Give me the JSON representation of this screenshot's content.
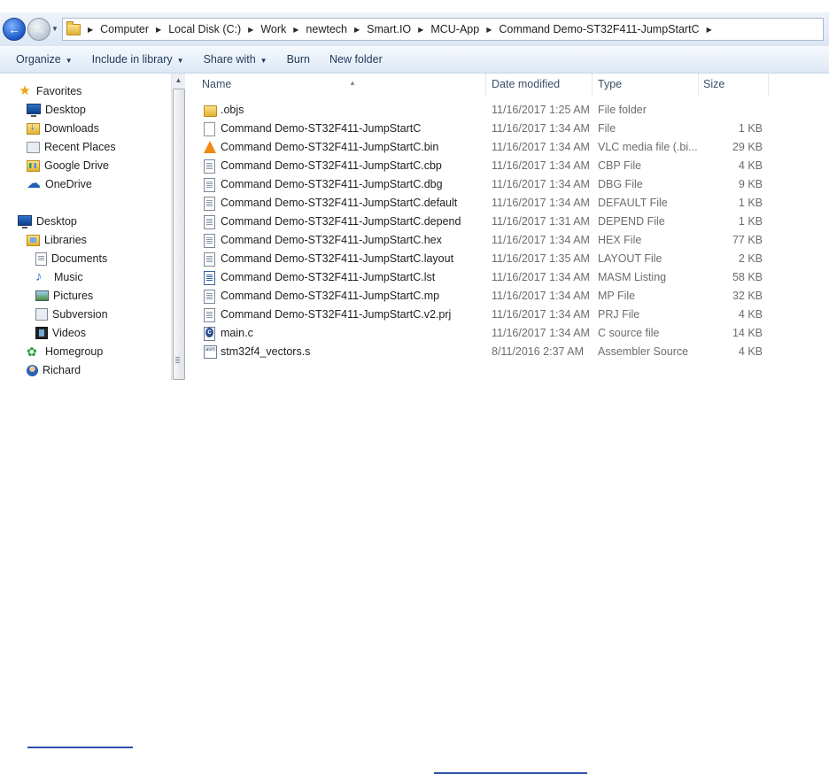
{
  "address": {
    "crumbs": [
      "Computer",
      "Local Disk (C:)",
      "Work",
      "newtech",
      "Smart.IO",
      "MCU-App",
      "Command Demo-ST32F411-JumpStartC"
    ]
  },
  "toolbar": {
    "organize": "Organize",
    "include_in_library": "Include in library",
    "share_with": "Share with",
    "burn": "Burn",
    "new_folder": "New folder"
  },
  "nav": {
    "favorites": "Favorites",
    "fav_items": [
      "Desktop",
      "Downloads",
      "Recent Places",
      "Google Drive",
      "OneDrive"
    ],
    "desktop": "Desktop",
    "libraries": "Libraries",
    "lib_items": [
      "Documents",
      "Music",
      "Pictures",
      "Subversion",
      "Videos"
    ],
    "homegroup": "Homegroup",
    "user": "Richard"
  },
  "columns": {
    "name": "Name",
    "date": "Date modified",
    "type": "Type",
    "size": "Size"
  },
  "files": [
    {
      "name": ".objs",
      "date": "11/16/2017 1:25 AM",
      "type": "File folder",
      "size": "",
      "icon": "folder-icon"
    },
    {
      "name": "Command Demo-ST32F411-JumpStartC",
      "date": "11/16/2017 1:34 AM",
      "type": "File",
      "size": "1 KB",
      "icon": "file-icon"
    },
    {
      "name": "Command Demo-ST32F411-JumpStartC.bin",
      "date": "11/16/2017 1:34 AM",
      "type": "VLC media file (.bi...",
      "size": "29 KB",
      "icon": "vlc-icon"
    },
    {
      "name": "Command Demo-ST32F411-JumpStartC.cbp",
      "date": "11/16/2017 1:34 AM",
      "type": "CBP File",
      "size": "4 KB",
      "icon": "text-file-icon"
    },
    {
      "name": "Command Demo-ST32F411-JumpStartC.dbg",
      "date": "11/16/2017 1:34 AM",
      "type": "DBG File",
      "size": "9 KB",
      "icon": "text-file-icon"
    },
    {
      "name": "Command Demo-ST32F411-JumpStartC.default",
      "date": "11/16/2017 1:34 AM",
      "type": "DEFAULT File",
      "size": "1 KB",
      "icon": "text-file-icon"
    },
    {
      "name": "Command Demo-ST32F411-JumpStartC.depend",
      "date": "11/16/2017 1:31 AM",
      "type": "DEPEND File",
      "size": "1 KB",
      "icon": "text-file-icon"
    },
    {
      "name": "Command Demo-ST32F411-JumpStartC.hex",
      "date": "11/16/2017 1:34 AM",
      "type": "HEX File",
      "size": "77 KB",
      "icon": "text-file-icon"
    },
    {
      "name": "Command Demo-ST32F411-JumpStartC.layout",
      "date": "11/16/2017 1:35 AM",
      "type": "LAYOUT File",
      "size": "2 KB",
      "icon": "text-file-icon"
    },
    {
      "name": "Command Demo-ST32F411-JumpStartC.lst",
      "date": "11/16/2017 1:34 AM",
      "type": "MASM Listing",
      "size": "58 KB",
      "icon": "listing-file-icon"
    },
    {
      "name": "Command Demo-ST32F411-JumpStartC.mp",
      "date": "11/16/2017 1:34 AM",
      "type": "MP File",
      "size": "32 KB",
      "icon": "text-file-icon"
    },
    {
      "name": "Command Demo-ST32F411-JumpStartC.v2.prj",
      "date": "11/16/2017 1:34 AM",
      "type": "PRJ File",
      "size": "4 KB",
      "icon": "text-file-icon"
    },
    {
      "name": "main.c",
      "date": "11/16/2017 1:34 AM",
      "type": "C source file",
      "size": "14 KB",
      "icon": "c-source-icon"
    },
    {
      "name": "stm32f4_vectors.s",
      "date": "8/11/2016 2:37 AM",
      "type": "Assembler Source",
      "size": "4 KB",
      "icon": "asm-file-icon"
    }
  ]
}
